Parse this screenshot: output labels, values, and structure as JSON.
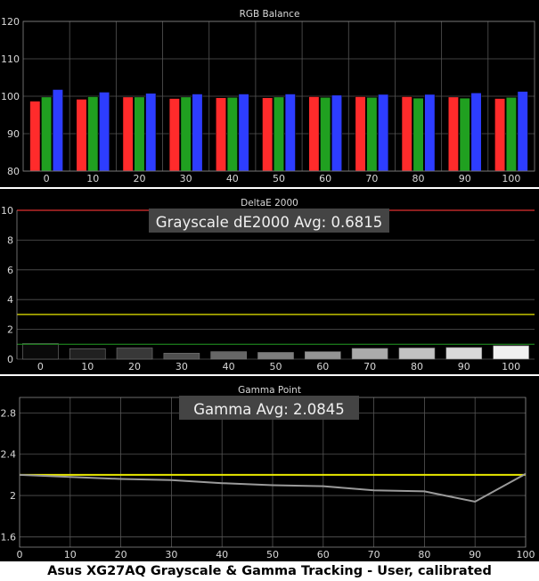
{
  "caption": "Asus XG27AQ Grayscale & Gamma Tracking - User, calibrated",
  "colors": {
    "background": "#000000",
    "grid": "#555555",
    "axis_text": "#d8d8d8",
    "red": "#ff2b2b",
    "green": "#20a020",
    "blue": "#2d3dff",
    "target_yellow": "#e8e800",
    "limit_red": "#e03030",
    "limit_green": "#1e8a1e",
    "gamma_line": "#9a9a9a",
    "annotation_bg": "#444444"
  },
  "chart_data": [
    {
      "type": "bar",
      "title": "RGB Balance",
      "categories": [
        "0",
        "10",
        "20",
        "30",
        "40",
        "50",
        "60",
        "70",
        "80",
        "90",
        "100"
      ],
      "series": [
        {
          "values": [
            98.7,
            99.2,
            99.8,
            99.4,
            99.6,
            99.6,
            99.9,
            99.9,
            99.9,
            99.8,
            99.4
          ]
        },
        {
          "values": [
            99.8,
            99.9,
            99.8,
            99.8,
            99.7,
            99.8,
            99.7,
            99.7,
            99.5,
            99.5,
            99.7
          ]
        },
        {
          "values": [
            101.8,
            101.1,
            100.8,
            100.6,
            100.6,
            100.6,
            100.3,
            100.5,
            100.5,
            100.9,
            101.3
          ]
        }
      ],
      "ylim": [
        80,
        120
      ],
      "yticks": [
        80,
        90,
        100,
        110,
        120
      ],
      "grid": true
    },
    {
      "type": "bar",
      "title": "DeltaE 2000",
      "categories": [
        "0",
        "10",
        "20",
        "30",
        "40",
        "50",
        "60",
        "70",
        "80",
        "90",
        "100"
      ],
      "values": [
        1.05,
        0.7,
        0.75,
        0.4,
        0.5,
        0.45,
        0.5,
        0.72,
        0.75,
        0.78,
        0.9
      ],
      "annotation": "Grayscale dE2000 Avg: 0.6815",
      "ylim": [
        0,
        10
      ],
      "yticks": [
        0,
        2,
        4,
        6,
        8,
        10
      ],
      "reference_lines": [
        {
          "y": 1,
          "color": "limit_green"
        },
        {
          "y": 3,
          "color": "target_yellow"
        },
        {
          "y": 10,
          "color": "limit_red"
        }
      ],
      "grid": true
    },
    {
      "type": "line",
      "title": "Gamma Point",
      "x": [
        0,
        10,
        20,
        30,
        40,
        50,
        60,
        70,
        80,
        90,
        100
      ],
      "series": [
        {
          "values": [
            2.2,
            2.18,
            2.16,
            2.15,
            2.12,
            2.1,
            2.09,
            2.05,
            2.04,
            1.94,
            2.21
          ]
        }
      ],
      "target": 2.2,
      "annotation": "Gamma Avg: 2.0845",
      "xticks": [
        0,
        10,
        20,
        30,
        40,
        50,
        60,
        70,
        80,
        90,
        100
      ],
      "yticks": [
        1.6,
        2,
        2.4,
        2.8
      ],
      "ylim": [
        1.5,
        2.95
      ],
      "xlim": [
        0,
        100
      ],
      "grid": true
    }
  ]
}
